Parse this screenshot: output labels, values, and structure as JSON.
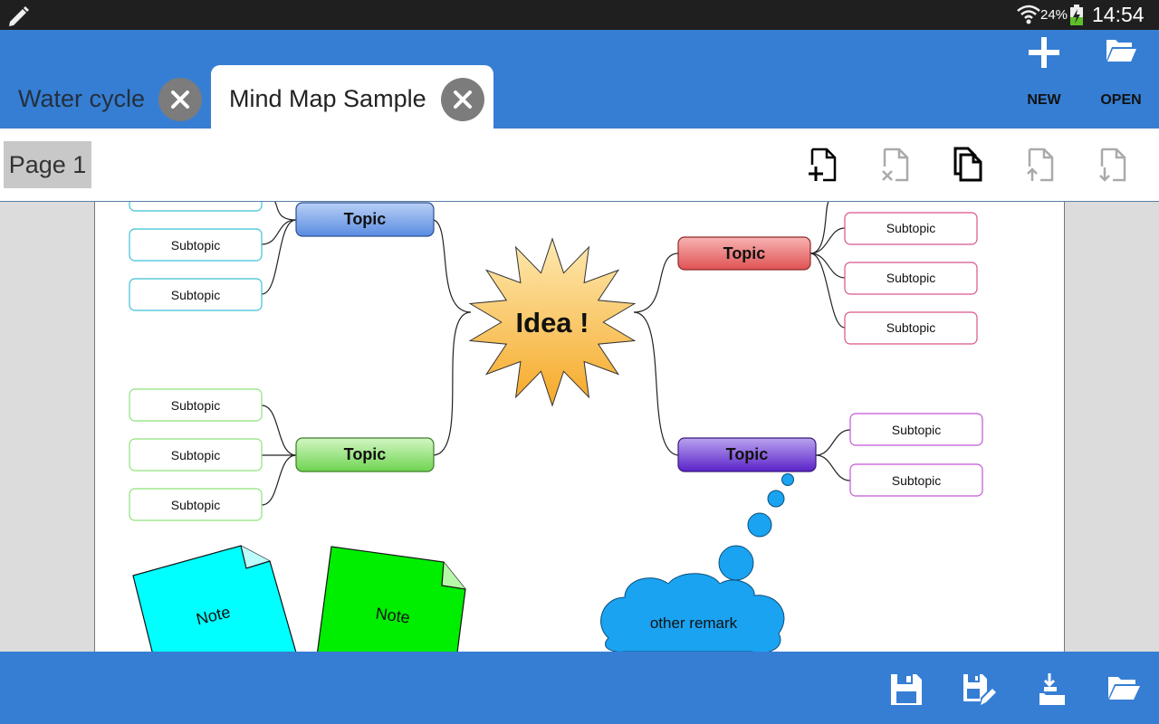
{
  "status_bar": {
    "battery": "24%",
    "time": "14:54"
  },
  "tabs": [
    {
      "label": "Water cycle"
    },
    {
      "label": "Mind Map Sample"
    }
  ],
  "header_actions": {
    "new_label": "NEW",
    "open_label": "OPEN"
  },
  "page_chip": "Page 1",
  "mindmap": {
    "central": "Idea !",
    "topics": [
      {
        "label": "Topic",
        "color": "#6f9ce8"
      },
      {
        "label": "Topic",
        "color": "#e96f6f"
      },
      {
        "label": "Topic",
        "color": "#86dd6a"
      },
      {
        "label": "Topic",
        "color": "#7a47dc"
      }
    ],
    "subtopics_left_top": [
      "Subtopic",
      "Subtopic"
    ],
    "subtopics_left_bottom": [
      "Subtopic",
      "Subtopic",
      "Subtopic"
    ],
    "subtopics_right_top": [
      "Subtopic",
      "Subtopic",
      "Subtopic"
    ],
    "subtopics_right_bottom": [
      "Subtopic",
      "Subtopic"
    ],
    "notes": [
      "Note",
      "Note"
    ],
    "remark": "other remark"
  },
  "colors": {
    "accent": "#367ed3",
    "statusbar": "#1f1f1f",
    "cloud": "#1aa3f1"
  }
}
